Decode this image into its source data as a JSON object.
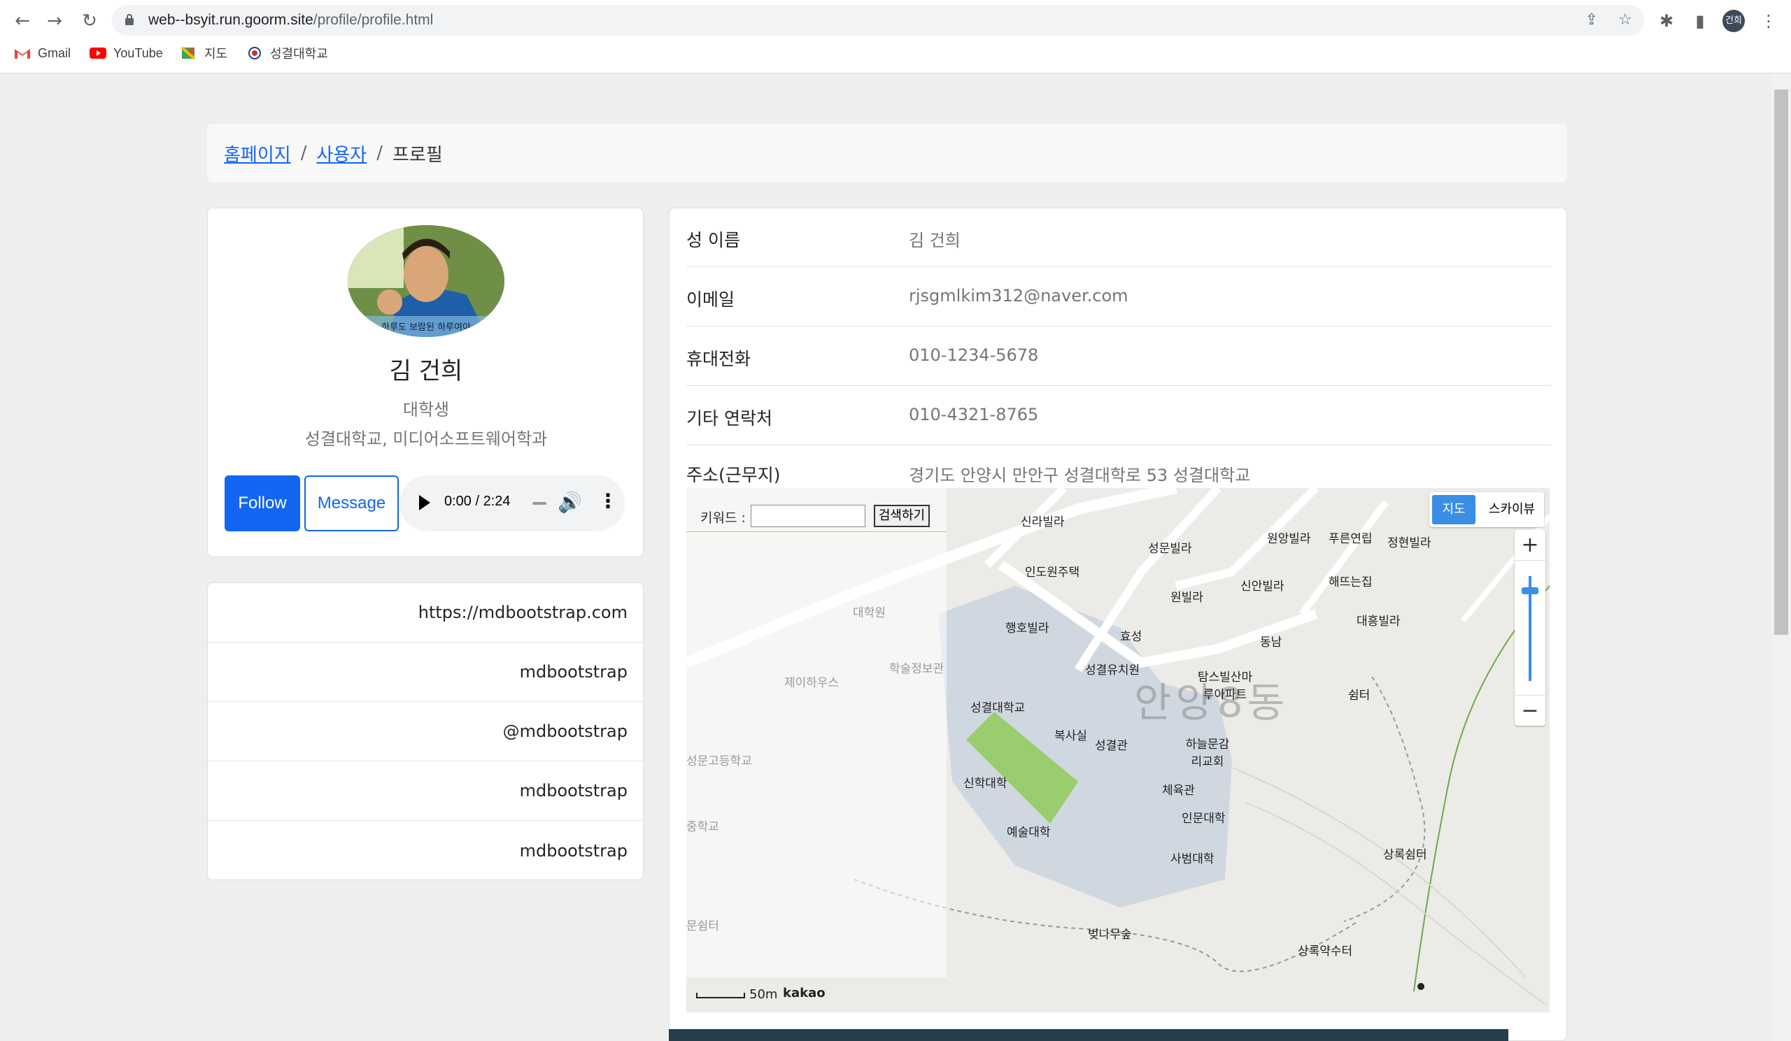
{
  "browser": {
    "url_host": "web--bsyit.run.goorm.site",
    "url_path": "/profile/profile.html",
    "avatar": "건희",
    "bookmarks": [
      {
        "label": "Gmail",
        "icon": "gmail-icon"
      },
      {
        "label": "YouTube",
        "icon": "youtube-icon"
      },
      {
        "label": "지도",
        "icon": "maps-icon"
      },
      {
        "label": "성결대학교",
        "icon": "university-icon"
      }
    ]
  },
  "breadcrumb": {
    "home": "홈페이지",
    "users": "사용자",
    "current": "프로필",
    "separator": "/"
  },
  "profile": {
    "photo_caption": "하루도 보람된 하루여야",
    "name": "김 건희",
    "role": "대학생",
    "school": "성결대학교, 미디어소프트웨어학과",
    "follow_label": "Follow",
    "message_label": "Message",
    "audio_time": "0:00 / 2:24"
  },
  "links": [
    "https://mdbootstrap.com",
    "mdbootstrap",
    "@mdbootstrap",
    "mdbootstrap",
    "mdbootstrap"
  ],
  "info": [
    {
      "label": "성 이름",
      "value": "김 건희"
    },
    {
      "label": "이메일",
      "value": "rjsgmlkim312@naver.com"
    },
    {
      "label": "휴대전화",
      "value": "010-1234-5678"
    },
    {
      "label": "기타 연락처",
      "value": "010-4321-8765"
    },
    {
      "label": "주소(근무지)",
      "value": "경기도 안양시 만안구 성결대학로 53 성결대학교"
    }
  ],
  "map": {
    "keyword_label": "키워드 :",
    "search_button": "검색하기",
    "type_map": "지도",
    "type_sky": "스카이뷰",
    "zoom_in": "+",
    "zoom_out": "−",
    "scale": "50m",
    "provider": "kakao",
    "area_name": "안양8동",
    "labels": {
      "sinra": "신라빌라",
      "sungmun": "성문빌라",
      "wonyang": "원앙빌라",
      "pureun": "푸른연립",
      "jeonghyeon": "정현빌라",
      "indowon": "인도원주택",
      "sinan": "신안빌라",
      "haeddeun": "해뜨는집",
      "wonvilla": "원빌라",
      "daeheung": "대흥빌라",
      "daehakwon": "대학원",
      "haengho": "행호빌라",
      "hyoseong": "효성",
      "dongnam": "동남",
      "jay": "제이하우스",
      "haksul": "학술정보관",
      "kindergarten": "성결유치원",
      "tamsu": "탐스빌산마루아파트",
      "shelter": "쉼터",
      "sku": "성결대학교",
      "boksa": "복사실",
      "sgwan": "성결관",
      "church": "하늘문감리교회",
      "highschool": "성문고등학교",
      "gym": "체육관",
      "theology": "신학대학",
      "humanities": "인문대학",
      "middle": "중학교",
      "arts": "예술대학",
      "education": "사범대학",
      "sangrok_shelter": "상록쉼터",
      "rest": "문쉼터",
      "cherry": "벚나무숲",
      "spring": "상록약수터"
    }
  }
}
